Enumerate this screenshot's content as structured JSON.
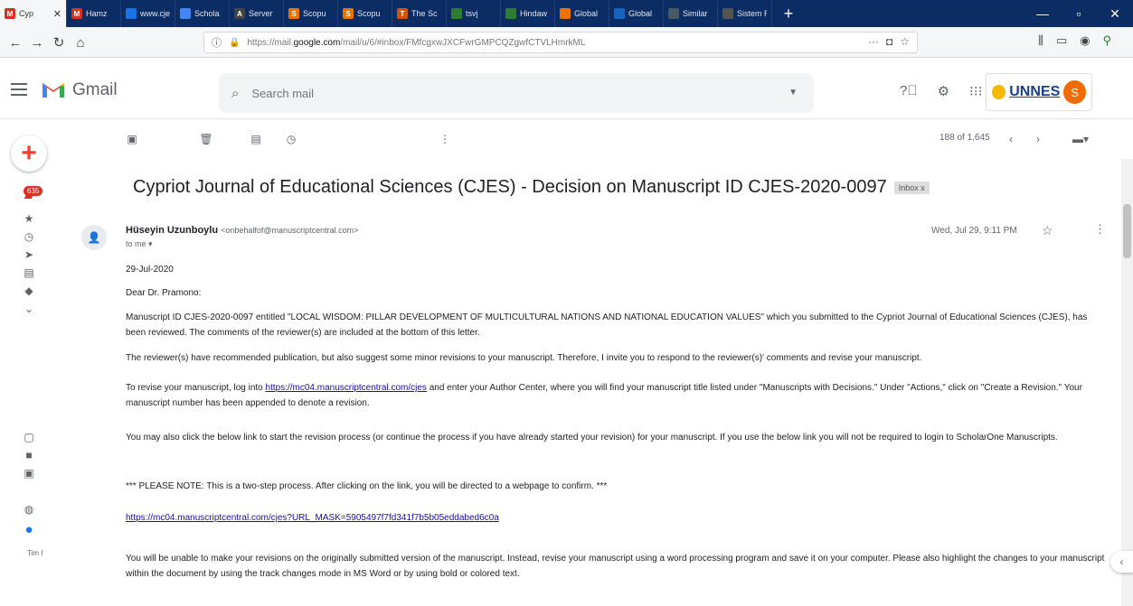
{
  "browser": {
    "tabs": [
      {
        "label": "Cyp",
        "fav": "M",
        "color": "#d93025"
      },
      {
        "label": "Hamz",
        "fav": "M",
        "color": "#d93025"
      },
      {
        "label": "www.cjes",
        "fav": "",
        "color": "#1a73e8"
      },
      {
        "label": "Schola",
        "fav": "",
        "color": "#4285f4"
      },
      {
        "label": "Server",
        "fav": "A",
        "color": "#444444"
      },
      {
        "label": "Scopu",
        "fav": "S",
        "color": "#e97300"
      },
      {
        "label": "Scopu",
        "fav": "S",
        "color": "#e97300"
      },
      {
        "label": "The Sc",
        "fav": "T",
        "color": "#d35400"
      },
      {
        "label": "tsvj",
        "fav": "",
        "color": "#2e7d32"
      },
      {
        "label": "Hindaw",
        "fav": "",
        "color": "#2e7d32"
      },
      {
        "label": "Global",
        "fav": "",
        "color": "#e97300"
      },
      {
        "label": "Global",
        "fav": "",
        "color": "#1565c0"
      },
      {
        "label": "Similar",
        "fav": "",
        "color": "#455a64"
      },
      {
        "label": "Sistem Rep",
        "fav": "",
        "color": "#555555"
      }
    ],
    "url_prefix": "https://mail.",
    "url_domain": "google.com",
    "url_rest": "/mail/u/6/#inbox/FMfcgxwJXCFwrGMPCQZgwfCTVLHmrkML"
  },
  "gmail": {
    "app_name": "Gmail",
    "search_placeholder": "Search mail",
    "org_logo": "UNNES",
    "avatar_letter": "S",
    "unread_badge": "635",
    "pager": "188 of 1,645",
    "rail_text": "Tim I"
  },
  "message": {
    "subject": "Cypriot Journal of Educational Sciences (CJES) - Decision on Manuscript ID CJES-2020-0097",
    "label": "Inbox x",
    "sender_name": "Hüseyin Uzunboylu",
    "sender_email": "<onbehalfof@manuscriptcentral.com>",
    "to": "to me ▾",
    "date": "Wed, Jul 29, 9:11 PM",
    "date_line": "29-Jul-2020",
    "greeting": "Dear Dr. Pramono:",
    "p1": "Manuscript ID CJES-2020-0097 entitled \"LOCAL WISDOM: PILLAR DEVELOPMENT OF MULTICULTURAL NATIONS AND NATIONAL EDUCATION VALUES\" which you submitted to the Cypriot Journal of Educational Sciences (CJES), has been reviewed. The comments of the reviewer(s) are included at the bottom of this letter.",
    "p2": "The reviewer(s) have recommended publication, but also suggest some minor revisions to your manuscript. Therefore, I invite you to respond to the reviewer(s)' comments and revise your manuscript.",
    "p3_before": "To revise your manuscript, log into ",
    "p3_link": "https://mc04.manuscriptcentral.com/cjes",
    "p3_after": " and enter your Author Center, where you will find your manuscript title listed under \"Manuscripts with Decisions.\" Under \"Actions,\" click on \"Create a Revision.\" Your manuscript number has been appended to denote a revision.",
    "p4": "You may also click the below link to start the revision process (or continue the process if you have already started your revision) for your manuscript. If you use the below link you will not be required to login to ScholarOne Manuscripts.",
    "p5": "*** PLEASE NOTE: This is a two-step process. After clicking on the link, you will be directed to a webpage to confirm. ***",
    "p6_link": "https://mc04.manuscriptcentral.com/cjes?URL_MASK=5905497f7fd341f7b5b05eddabed6c0a",
    "p7": "You will be unable to make your revisions on the originally submitted version of the manuscript. Instead, revise your manuscript using a word processing program and save it on your computer. Please also highlight the changes to your manuscript within the document by using the track changes mode in MS Word or by using bold or colored text."
  }
}
